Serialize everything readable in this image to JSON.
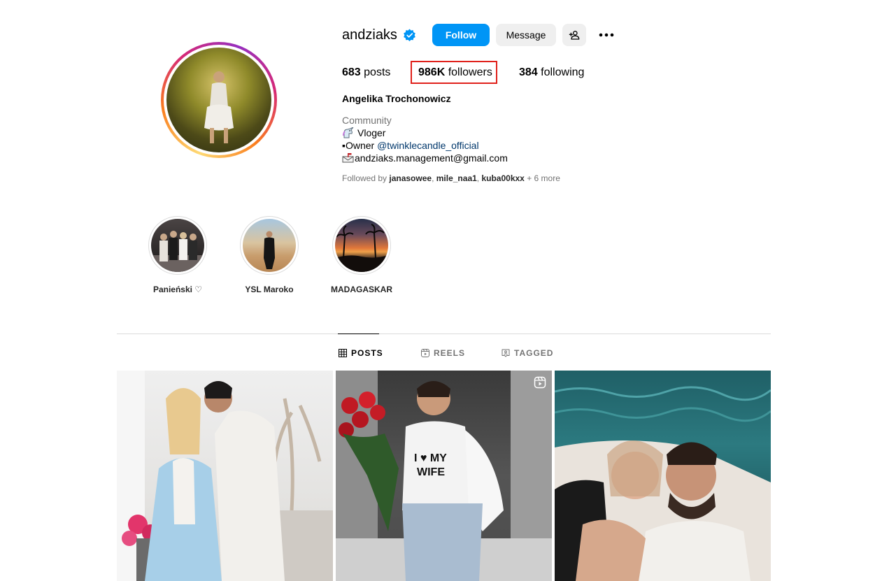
{
  "profile": {
    "username": "andziaks",
    "verified": true,
    "full_name": "Angelika Trochonowicz",
    "category": "Community",
    "bio_lines": {
      "line1": "Vloger",
      "line2_prefix": "▪Owner ",
      "line2_link": "@twinklecandle_official",
      "line3": "andziaks.management@gmail.com"
    }
  },
  "actions": {
    "follow_label": "Follow",
    "message_label": "Message"
  },
  "stats": {
    "posts_count": "683",
    "posts_label": "posts",
    "followers_count": "986K",
    "followers_label": "followers",
    "following_count": "384",
    "following_label": "following"
  },
  "followed_by": {
    "prefix": "Followed by ",
    "user1": "janasowee",
    "user2": "mile_naa1",
    "user3": "kuba00kxx",
    "suffix": " + 6 more"
  },
  "highlights": [
    {
      "label": "Panieński ♡"
    },
    {
      "label": "YSL Maroko"
    },
    {
      "label": "MADAGASKAR"
    }
  ],
  "tabs": [
    {
      "label": "POSTS",
      "active": true
    },
    {
      "label": "REELS",
      "active": false
    },
    {
      "label": "TAGGED",
      "active": false
    }
  ],
  "colors": {
    "accent": "#0095f6",
    "highlight_box": "#e0211b",
    "link": "#00376b",
    "muted": "#737373"
  }
}
